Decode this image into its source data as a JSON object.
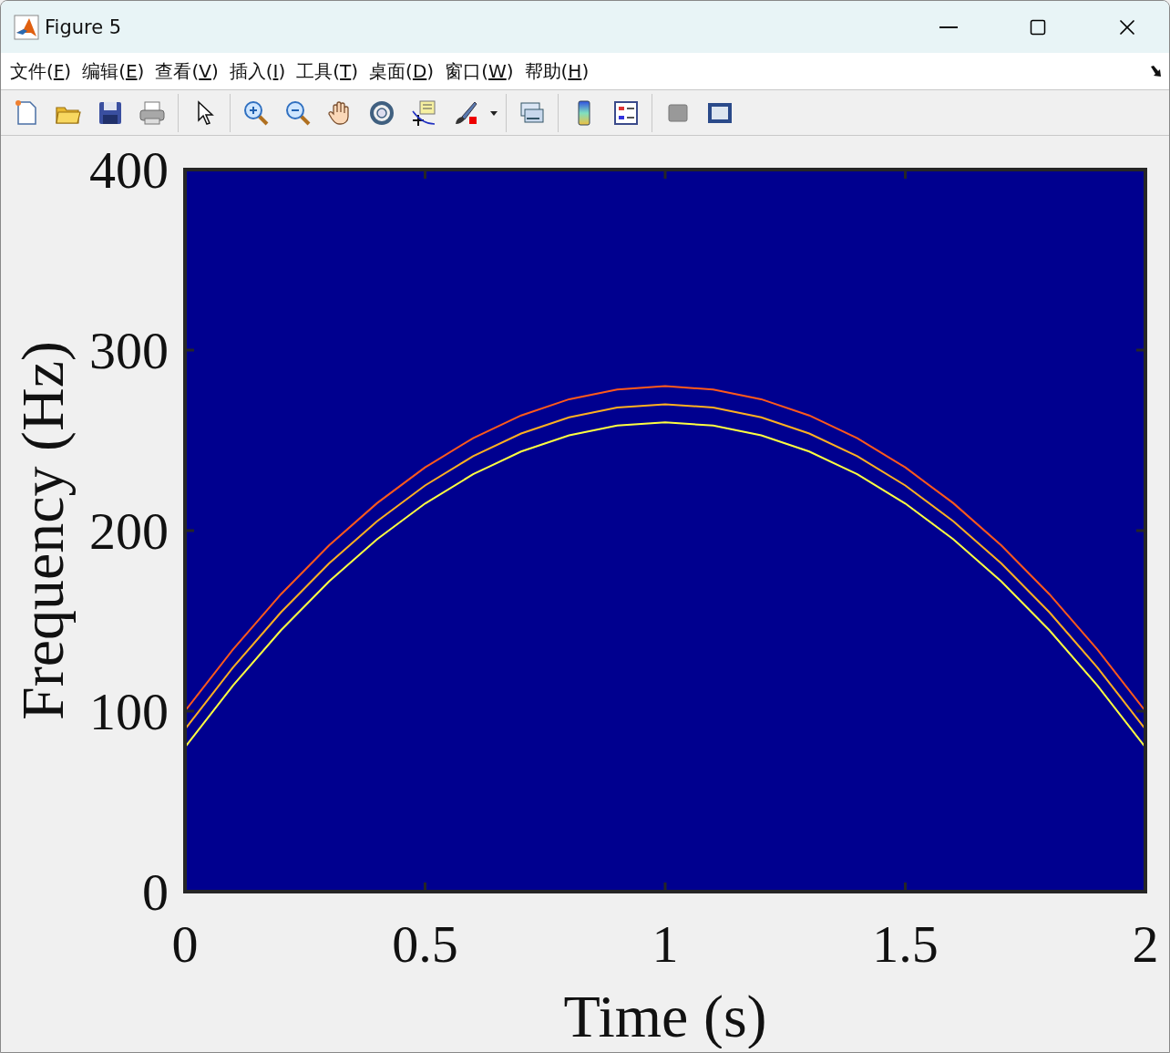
{
  "window": {
    "title": "Figure 5"
  },
  "menu": [
    {
      "label": "文件(F)"
    },
    {
      "label": "编辑(E)"
    },
    {
      "label": "查看(V)"
    },
    {
      "label": "插入(I)"
    },
    {
      "label": "工具(T)"
    },
    {
      "label": "桌面(D)"
    },
    {
      "label": "窗口(W)"
    },
    {
      "label": "帮助(H)"
    }
  ],
  "figure": {
    "chart_data": {
      "type": "line",
      "xlabel": "Time (s)",
      "ylabel": "Frequency (Hz)",
      "xlim": [
        0,
        2
      ],
      "ylim": [
        0,
        400
      ],
      "xticks": [
        0,
        0.5,
        1,
        1.5,
        2
      ],
      "yticks": [
        0,
        100,
        200,
        300,
        400
      ],
      "x": [
        0,
        0.1,
        0.2,
        0.3,
        0.4,
        0.5,
        0.6,
        0.7,
        0.8,
        0.9,
        1,
        1.1,
        1.2,
        1.3,
        1.4,
        1.5,
        1.6,
        1.7,
        1.8,
        1.9,
        2
      ],
      "series": [
        {
          "color": "#ff5a1a",
          "values": [
            100,
            134.2,
            164.8,
            191.8,
            215.2,
            235,
            251.2,
            263.8,
            272.8,
            278.2,
            280,
            278.2,
            272.8,
            263.8,
            251.2,
            235,
            215.2,
            191.8,
            164.8,
            134.2,
            100
          ]
        },
        {
          "color": "#ffb020",
          "values": [
            90,
            124.2,
            154.8,
            181.8,
            205.2,
            225,
            241.2,
            253.8,
            262.8,
            268.2,
            270,
            268.2,
            262.8,
            253.8,
            241.2,
            225,
            205.2,
            181.8,
            154.8,
            124.2,
            90
          ]
        },
        {
          "color": "#ffff40",
          "values": [
            80,
            114.2,
            144.8,
            171.8,
            195.2,
            215,
            231.2,
            243.8,
            252.8,
            258.2,
            260,
            258.2,
            252.8,
            243.8,
            231.2,
            215,
            195.2,
            171.8,
            144.8,
            114.2,
            80
          ]
        }
      ]
    }
  }
}
